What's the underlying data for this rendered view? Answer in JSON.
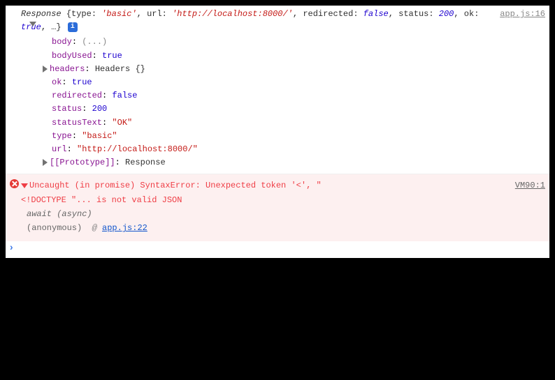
{
  "log": {
    "source": "app.js:16",
    "object_name": "Response",
    "summary": {
      "type_key": "type",
      "type_val": "'basic'",
      "url_key": "url",
      "url_val": "'http://localhost:8000/'",
      "redir_key": "redirected",
      "redir_val": "false",
      "status_key": "status",
      "status_val": "200",
      "ok_key": "ok",
      "ok_val": "true",
      "more": "…"
    },
    "info_badge": "i",
    "props": [
      {
        "key": "body",
        "val": "(...)",
        "cls": "ellipsis",
        "tri": false
      },
      {
        "key": "bodyUsed",
        "val": "true",
        "cls": "bool",
        "tri": false
      },
      {
        "key": "headers",
        "val": "Headers {}",
        "cls": "headers-val",
        "tri": true
      },
      {
        "key": "ok",
        "val": "true",
        "cls": "bool",
        "tri": false
      },
      {
        "key": "redirected",
        "val": "false",
        "cls": "bool",
        "tri": false
      },
      {
        "key": "status",
        "val": "200",
        "cls": "num",
        "tri": false
      },
      {
        "key": "statusText",
        "val": "\"OK\"",
        "cls": "str",
        "tri": false
      },
      {
        "key": "type",
        "val": "\"basic\"",
        "cls": "str",
        "tri": false
      },
      {
        "key": "url",
        "val": "\"http://localhost:8000/\"",
        "cls": "str",
        "tri": false
      },
      {
        "key": "[[Prototype]]",
        "val": "Response",
        "cls": "proto-val",
        "tri": true
      }
    ]
  },
  "error": {
    "source": "VM90:1",
    "message_line1": "Uncaught (in promise) SyntaxError: Unexpected token '<', \"",
    "message_line2": "<!DOCTYPE \"... is not valid JSON",
    "stack_await": "await (async)",
    "stack_anon": "(anonymous)",
    "stack_at": "@",
    "stack_src": "app.js:22"
  },
  "prompt": "›"
}
